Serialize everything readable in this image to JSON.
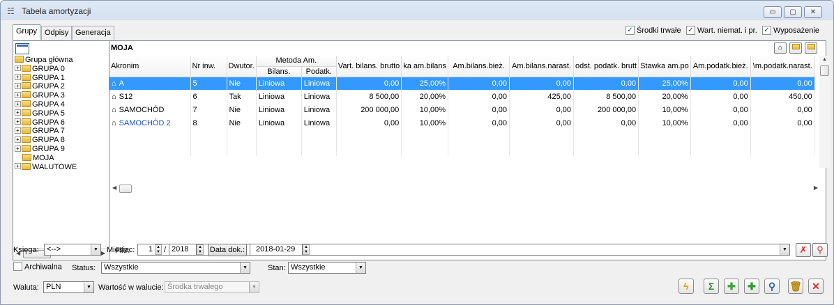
{
  "window": {
    "title": "Tabela amortyzacji"
  },
  "tabs": [
    "Grupy",
    "Odpisy",
    "Generacja"
  ],
  "filters_top": [
    {
      "label": "Środki trwałe",
      "checked": true
    },
    {
      "label": "Wart. niemat. i pr.",
      "checked": true
    },
    {
      "label": "Wyposażenie",
      "checked": true
    }
  ],
  "tree": {
    "root": "Grupa główna",
    "items": [
      "GRUPA 0",
      "GRUPA 1",
      "GRUPA 2",
      "GRUPA 3",
      "GRUPA 4",
      "GRUPA 5",
      "GRUPA 6",
      "GRUPA 7",
      "GRUPA 8",
      "GRUPA 9",
      "MOJA",
      "WALUTOWE"
    ]
  },
  "group_title": "MOJA",
  "table": {
    "header_group": "Metoda Am.",
    "columns": [
      "Akronim",
      "Nr inw.",
      "Dwutor.",
      "Bilans.",
      "Podatk.",
      "Wart. bilans. brutto",
      "Stawka am.bilans",
      "Am.bilans.bież.",
      "Am.bilans.narast.",
      "Wart. podst. podatk. brutto",
      "Stawka am.podatk.",
      "Am.podatk.bież.",
      "Am.podatk.narast."
    ],
    "column_display": [
      "Akronim",
      "Nr inw.",
      "Dwutor.",
      "Bilans.",
      "Podatk.",
      "Vart. bilans. brutto",
      "ka am.bilans",
      "Am.bilans.bież.",
      "Am.bilans.narast.",
      "odst. podatk. brutt",
      "Stawka am.po",
      "Am.podatk.bież.",
      "\\m.podatk.narast."
    ],
    "rows": [
      {
        "ak": "A",
        "nr": "5",
        "dw": "Nie",
        "bil": "Liniowa",
        "pod": "Liniowa",
        "wbb": "0,00",
        "sab": "25,00%",
        "abb": "0,00",
        "abn": "0,00",
        "wpp": "0,00",
        "sap": "25,00%",
        "apb": "0,00",
        "apn": "0,00",
        "selected": true,
        "blue": true
      },
      {
        "ak": "S12",
        "nr": "6",
        "dw": "Tak",
        "bil": "Liniowa",
        "pod": "Liniowa",
        "wbb": "8 500,00",
        "sab": "20,00%",
        "abb": "0,00",
        "abn": "425,00",
        "wpp": "8 500,00",
        "sap": "20,00%",
        "apb": "0,00",
        "apn": "450,00",
        "selected": false,
        "blue": false
      },
      {
        "ak": "SAMOCHÓD",
        "nr": "7",
        "dw": "Nie",
        "bil": "Liniowa",
        "pod": "Liniowa",
        "wbb": "200 000,00",
        "sab": "10,00%",
        "abb": "0,00",
        "abn": "0,00",
        "wpp": "200 000,00",
        "sap": "10,00%",
        "apb": "0,00",
        "apn": "0,00",
        "selected": false,
        "blue": false
      },
      {
        "ak": "SAMOCHÓD 2",
        "nr": "8",
        "dw": "Nie",
        "bil": "Liniowa",
        "pod": "Liniowa",
        "wbb": "0,00",
        "sab": "10,00%",
        "abb": "0,00",
        "abn": "0,00",
        "wpp": "0,00",
        "sap": "10,00%",
        "apb": "0,00",
        "apn": "0,00",
        "selected": false,
        "blue": true
      }
    ]
  },
  "filter": {
    "label": "Filtr:",
    "value": ""
  },
  "bottom": {
    "ksiega_label": "Księga:",
    "ksiega_value": "<-->",
    "miesiac_label": "Miesiac:",
    "miesiac_value": "1",
    "rok_value": "2018",
    "data_dok_label": "Data dok.:",
    "data_dok_value": "2018-01-29",
    "archiwalna_label": "Archiwalna",
    "archiwalna_checked": false,
    "status_label": "Status:",
    "status_value": "Wszystkie",
    "stan_label": "Stan:",
    "stan_value": "Wszystkie",
    "waluta_label": "Waluta:",
    "waluta_value": "PLN",
    "wartosc_label": "Wartość w walucie:",
    "wartosc_value": "Środka trwałego"
  },
  "icons": {
    "app": "table-icon",
    "selection": "house-icon"
  },
  "colors": {
    "selection": "#3399ff",
    "link": "#1a4fd6",
    "delete": "#d9302c"
  }
}
